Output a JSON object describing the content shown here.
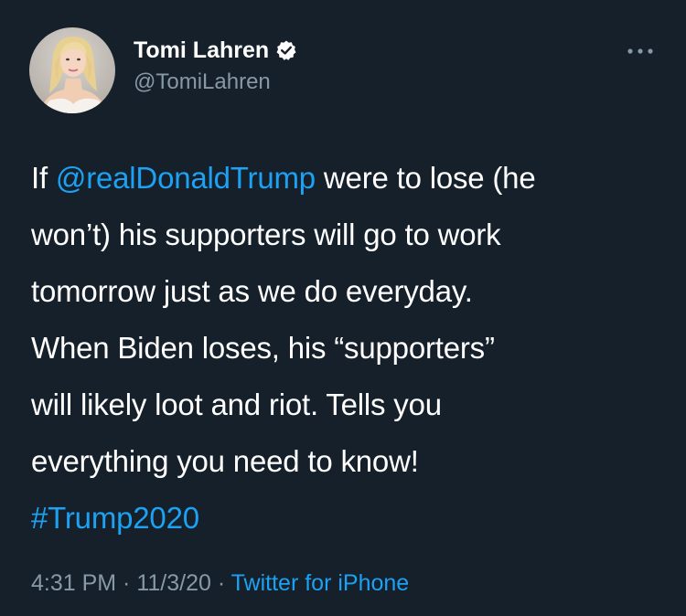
{
  "author": {
    "display_name": "Tomi Lahren",
    "handle": "@TomiLahren",
    "avatar_icon": "profile-photo",
    "verified_icon": "verified-badge-icon"
  },
  "more_icon": "more-options-icon",
  "tweet": {
    "line1_prefix": "If ",
    "mention": "@realDonaldTrump",
    "line1_suffix": " were to lose (he",
    "line2": "won’t) his supporters will go to work",
    "line3": "tomorrow just as we do everyday.",
    "line4": "When Biden loses, his “supporters”",
    "line5": "will likely loot and riot. Tells you",
    "line6": "everything you need to know!",
    "hashtag": "#Trump2020"
  },
  "meta": {
    "time": "4:31 PM",
    "separator1": " · ",
    "date": "11/3/20",
    "separator2": " · ",
    "source": "Twitter for iPhone"
  },
  "colors": {
    "background": "#15202b",
    "link": "#1da1f2",
    "secondary_text": "#8899a6"
  }
}
